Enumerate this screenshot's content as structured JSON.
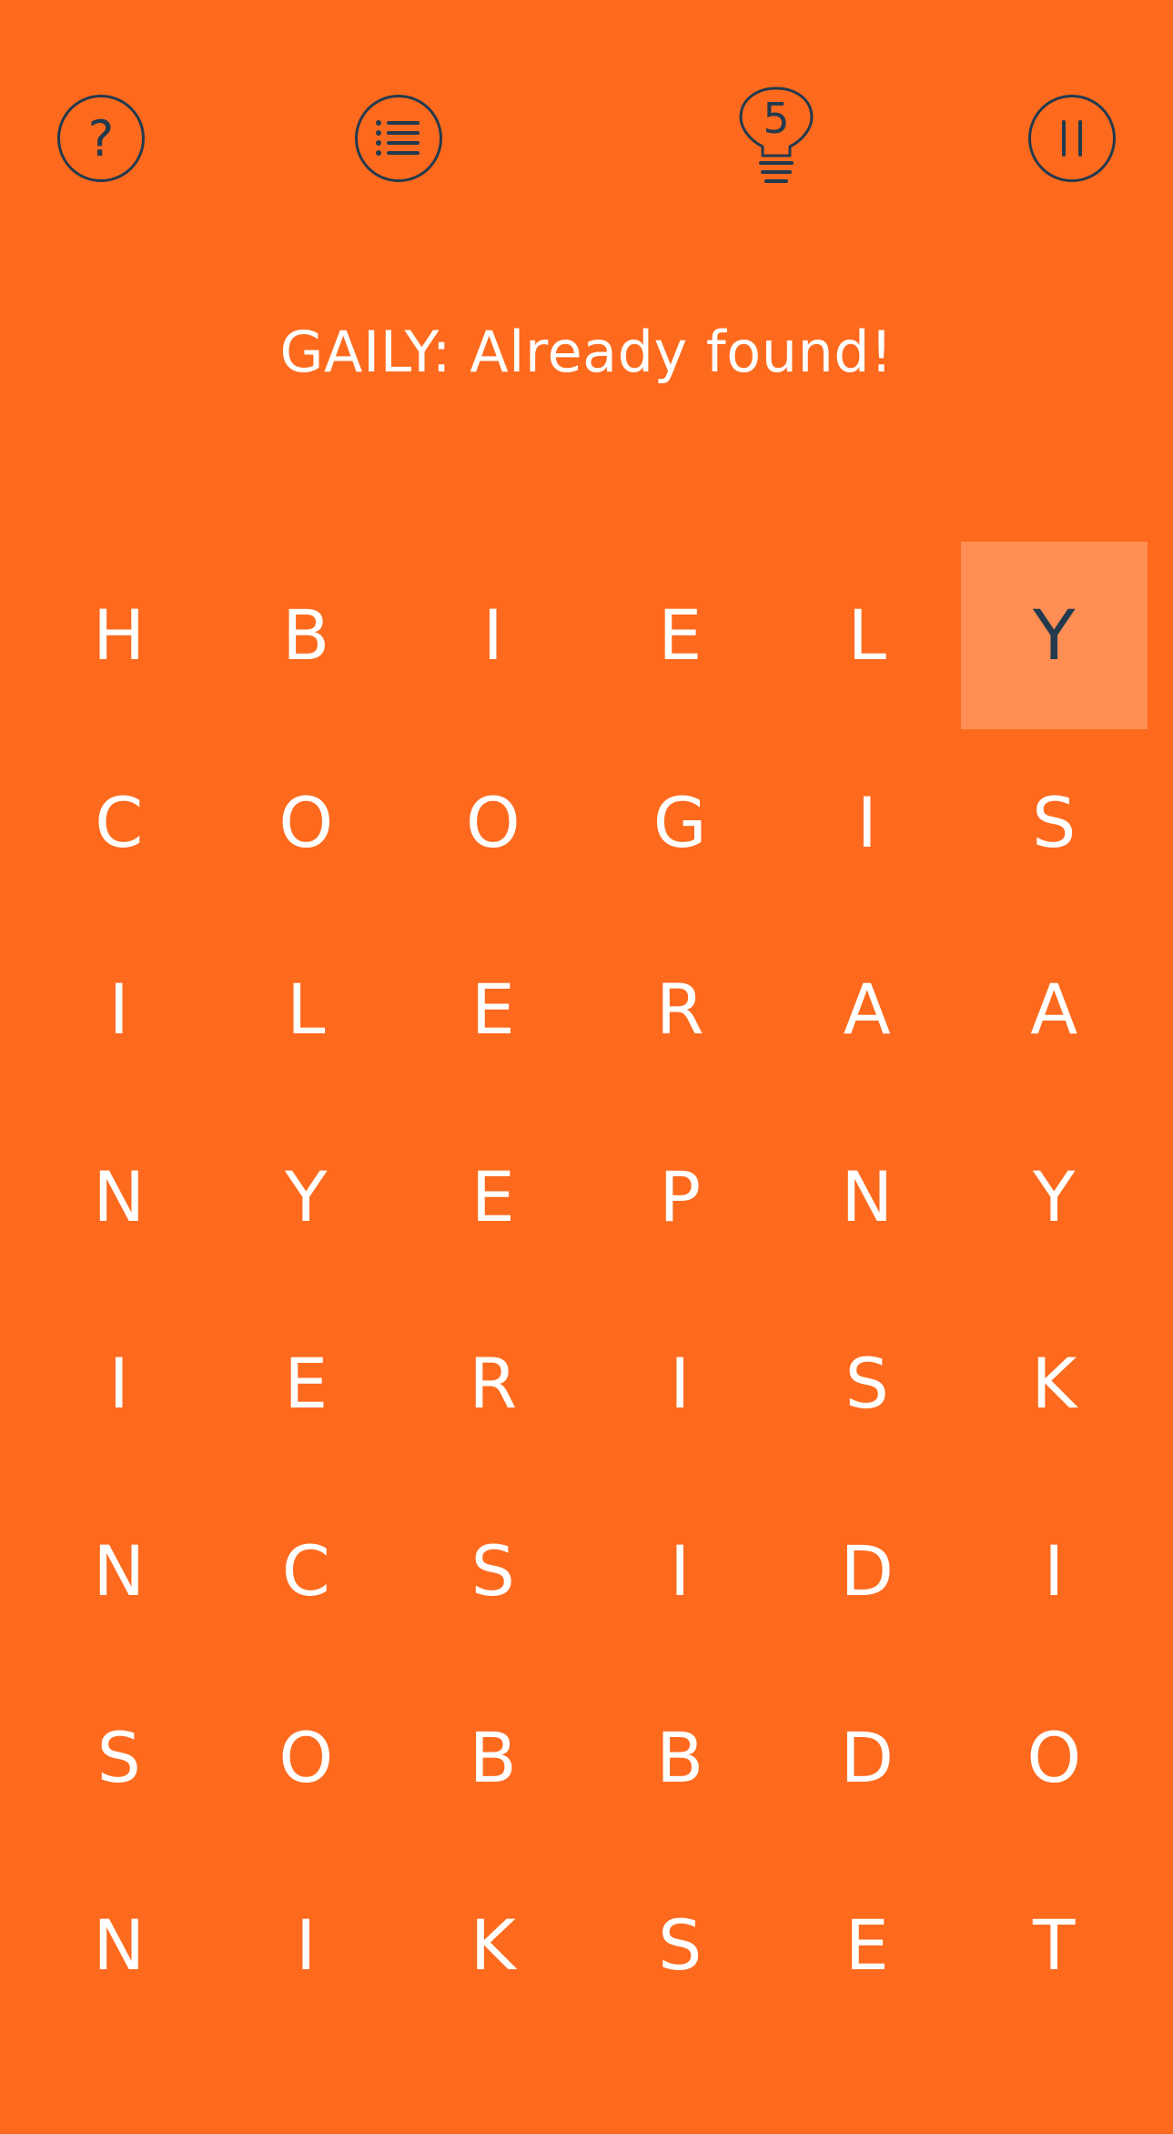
{
  "topbar": {
    "help_icon": "question-mark-icon",
    "list_icon": "list-icon",
    "hint_icon": "lightbulb-icon",
    "hint_count": "5",
    "pause_icon": "pause-icon"
  },
  "status_message": "GAILY: Already found!",
  "colors": {
    "background": "#FD6A1D",
    "selected_cell": "#FF8E55",
    "icon": "#223A4E",
    "letter": "#FFFFFF"
  },
  "grid": {
    "columns": 6,
    "rows": [
      [
        "H",
        "B",
        "I",
        "E",
        "L",
        "Y"
      ],
      [
        "C",
        "O",
        "O",
        "G",
        "I",
        "S"
      ],
      [
        "I",
        "L",
        "E",
        "R",
        "A",
        "A"
      ],
      [
        "N",
        "Y",
        "E",
        "P",
        "N",
        "Y"
      ],
      [
        "I",
        "E",
        "R",
        "I",
        "S",
        "K"
      ],
      [
        "N",
        "C",
        "S",
        "I",
        "D",
        "I"
      ],
      [
        "S",
        "O",
        "B",
        "B",
        "D",
        "O"
      ],
      [
        "N",
        "I",
        "K",
        "S",
        "E",
        "T"
      ]
    ],
    "selected_cells": [
      [
        0,
        5
      ]
    ]
  }
}
